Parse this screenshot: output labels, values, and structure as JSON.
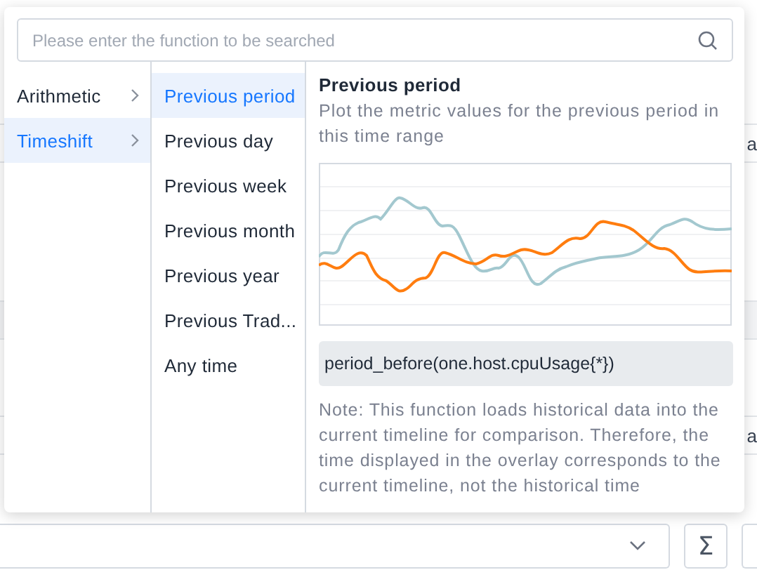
{
  "background": {
    "fragments": [
      {
        "text": "a"
      },
      {
        "text": "a"
      }
    ]
  },
  "popup": {
    "search": {
      "placeholder": "Please enter the function to be searched"
    },
    "categories": [
      {
        "label": "Arithmetic",
        "selected": false
      },
      {
        "label": "Timeshift",
        "selected": true
      }
    ],
    "functions": [
      {
        "label": "Previous period",
        "selected": true
      },
      {
        "label": "Previous day",
        "selected": false
      },
      {
        "label": "Previous week",
        "selected": false
      },
      {
        "label": "Previous month",
        "selected": false
      },
      {
        "label": "Previous year",
        "selected": false
      },
      {
        "label": "Previous Trad...",
        "selected": false
      },
      {
        "label": "Any time",
        "selected": false
      }
    ],
    "detail": {
      "title": "Previous period",
      "description": "Plot the metric values for the previous period in this time range",
      "code": "period_before(one.host.cpuUsage{*})",
      "note": "Note: This function loads historical data into the current timeline for comparison. Therefore, the time displayed in the overlay corresponds to the current timeline, not the historical time"
    }
  },
  "bottom_bar": {
    "sum_button": "Σ"
  }
}
